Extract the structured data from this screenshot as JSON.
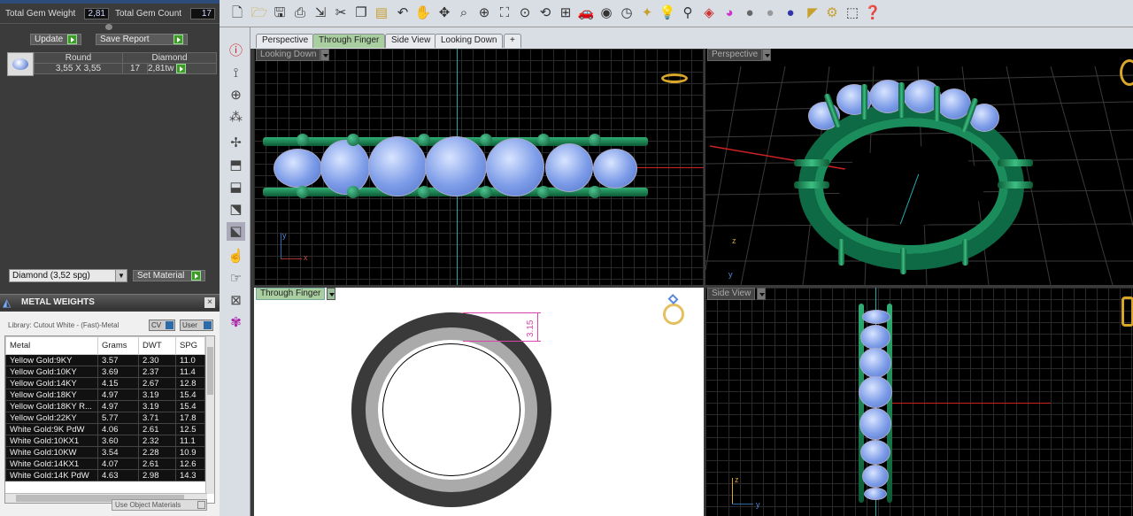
{
  "gem_summary": {
    "total_weight_label": "Total Gem Weight",
    "total_weight": "2,81",
    "total_count_label": "Total Gem Count",
    "total_count": "17"
  },
  "buttons": {
    "update": "Update",
    "save_report": "Save Report",
    "set_material": "Set Material"
  },
  "gem_table": {
    "headers": [
      "Round",
      "Diamond"
    ],
    "size": "3,55 X 3,55",
    "count": "17",
    "weight": "2,81tw"
  },
  "material_select": "Diamond   (3,52 spg)",
  "metal_weights": {
    "title": "METAL WEIGHTS",
    "library": "Library: Cutout White - (Fast)-Metal",
    "cv": "CV",
    "user": "User",
    "headers": [
      "Metal",
      "Grams",
      "DWT",
      "SPG"
    ],
    "rows": [
      [
        "Yellow Gold:9KY",
        "3.57",
        "2.30",
        "11.0"
      ],
      [
        "Yellow Gold:10KY",
        "3.69",
        "2.37",
        "11.4"
      ],
      [
        "Yellow Gold:14KY",
        "4.15",
        "2.67",
        "12.8"
      ],
      [
        "Yellow Gold:18KY",
        "4.97",
        "3.19",
        "15.4"
      ],
      [
        "Yellow Gold:18KY R...",
        "4.97",
        "3.19",
        "15.4"
      ],
      [
        "Yellow Gold:22KY",
        "5.77",
        "3.71",
        "17.8"
      ],
      [
        "White Gold:9K PdW",
        "4.06",
        "2.61",
        "12.5"
      ],
      [
        "White Gold:10KX1",
        "3.60",
        "2.32",
        "11.1"
      ],
      [
        "White Gold:10KW",
        "3.54",
        "2.28",
        "10.9"
      ],
      [
        "White Gold:14KX1",
        "4.07",
        "2.61",
        "12.6"
      ],
      [
        "White Gold:14K PdW",
        "4.63",
        "2.98",
        "14.3"
      ]
    ],
    "use_object_materials": "Use Object Materials"
  },
  "tabs": [
    "Perspective",
    "Through Finger",
    "Side View",
    "Looking Down",
    "+"
  ],
  "viewports": {
    "top_left": "Looking Down",
    "top_right": "Perspective",
    "bottom_left": "Through Finger",
    "bottom_right": "Side View"
  },
  "dimension": "3.15",
  "axes": {
    "x": "x",
    "y": "y",
    "z": "z"
  }
}
